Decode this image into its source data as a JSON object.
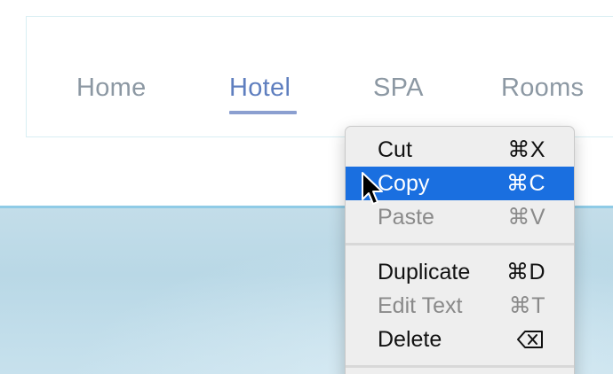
{
  "nav": {
    "items": [
      {
        "label": "Home",
        "active": false
      },
      {
        "label": "Hotel",
        "active": true
      },
      {
        "label": "SPA",
        "active": false
      },
      {
        "label": "Rooms",
        "active": false
      }
    ]
  },
  "context_menu": {
    "items": [
      {
        "label": "Cut",
        "shortcut": "⌘X",
        "state": "enabled"
      },
      {
        "label": "Copy",
        "shortcut": "⌘C",
        "state": "highlighted"
      },
      {
        "label": "Paste",
        "shortcut": "⌘V",
        "state": "disabled"
      },
      {
        "label": "Duplicate",
        "shortcut": "⌘D",
        "state": "enabled"
      },
      {
        "label": "Edit Text",
        "shortcut": "⌘T",
        "state": "disabled"
      },
      {
        "label": "Delete",
        "shortcut_icon": "delete-key-icon",
        "state": "enabled"
      }
    ]
  },
  "colors": {
    "nav_active": "#5f7fbf",
    "nav_inactive": "#8c98a3",
    "menu_highlight": "#1a6fe0",
    "hero": "#c3dde9"
  },
  "icons": {
    "cursor": "arrow-cursor-icon",
    "delete_key": "delete-key-icon"
  }
}
